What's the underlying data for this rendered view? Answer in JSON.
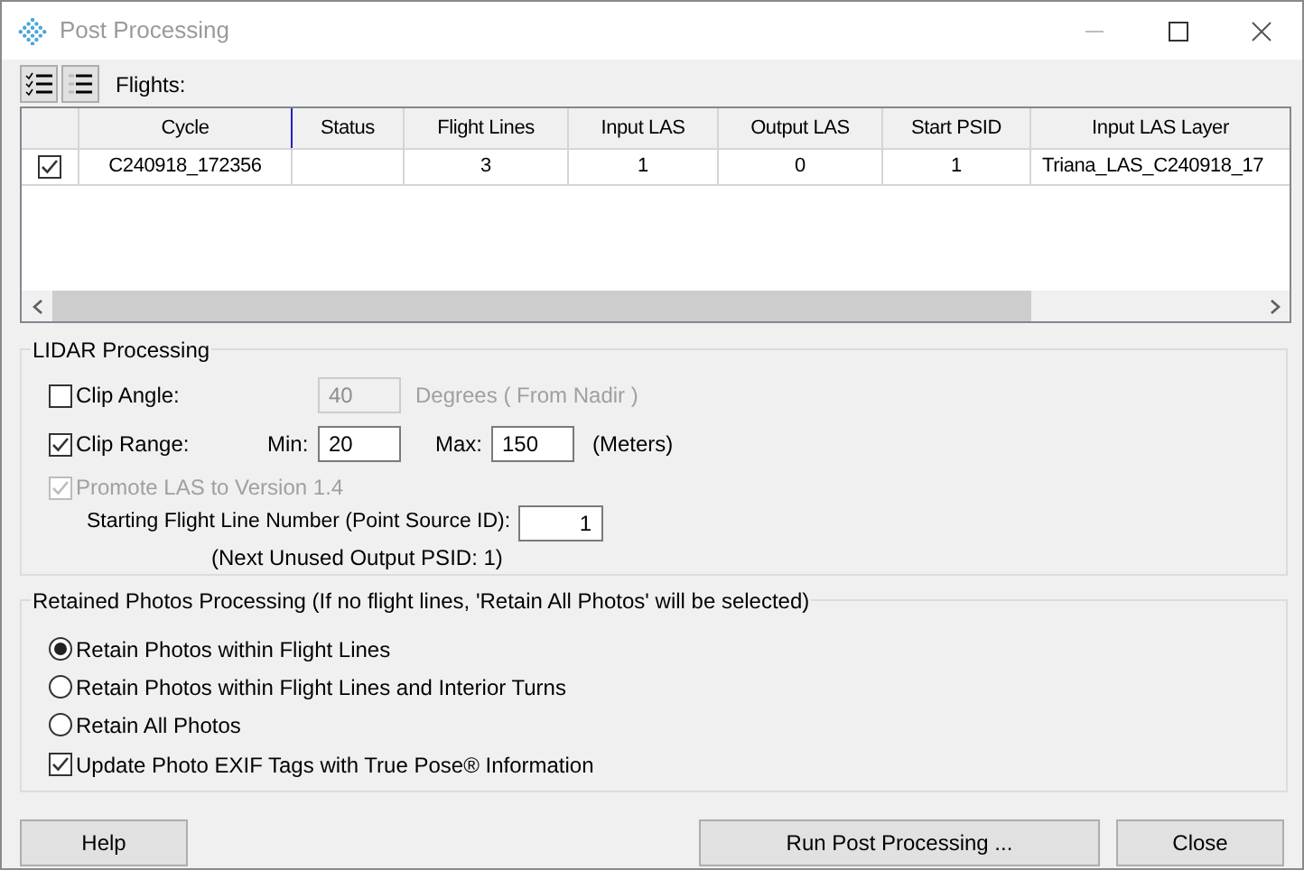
{
  "window": {
    "title": "Post Processing"
  },
  "flights_label": "Flights:",
  "table": {
    "columns": [
      "",
      "Cycle",
      "Status",
      "Flight Lines",
      "Input LAS",
      "Output LAS",
      "Start PSID",
      "Input LAS Layer"
    ],
    "rows": [
      {
        "checked": true,
        "cells": [
          "",
          "C240918_172356",
          "",
          "3",
          "1",
          "0",
          "1",
          "Triana_LAS_C240918_17"
        ]
      }
    ]
  },
  "lidar_processing": {
    "title": "LIDAR Processing",
    "clip_angle": {
      "label": "Clip Angle:",
      "checked": false,
      "value": "40",
      "unit": "Degrees ( From Nadir )"
    },
    "clip_range": {
      "label": "Clip Range:",
      "checked": true,
      "min_label": "Min:",
      "min_value": "20",
      "max_label": "Max:",
      "max_value": "150",
      "unit": "(Meters)"
    },
    "promote": {
      "label": "Promote LAS to Version 1.4",
      "checked": true,
      "disabled": true
    },
    "start_line": {
      "label": "Starting Flight Line Number (Point Source ID):",
      "value": "1",
      "note": "(Next Unused Output PSID: 1)"
    }
  },
  "retained_photos": {
    "title": "Retained Photos Processing  (If no flight lines, 'Retain All Photos' will be selected)",
    "options": [
      {
        "label": "Retain Photos within Flight Lines",
        "selected": true
      },
      {
        "label": "Retain Photos within Flight Lines and Interior Turns",
        "selected": false
      },
      {
        "label": "Retain All Photos",
        "selected": false
      }
    ],
    "update_exif": {
      "label": "Update Photo EXIF Tags with True Pose® Information",
      "checked": true
    }
  },
  "buttons": [
    "Help",
    "Run Post Processing ...",
    "Close"
  ]
}
